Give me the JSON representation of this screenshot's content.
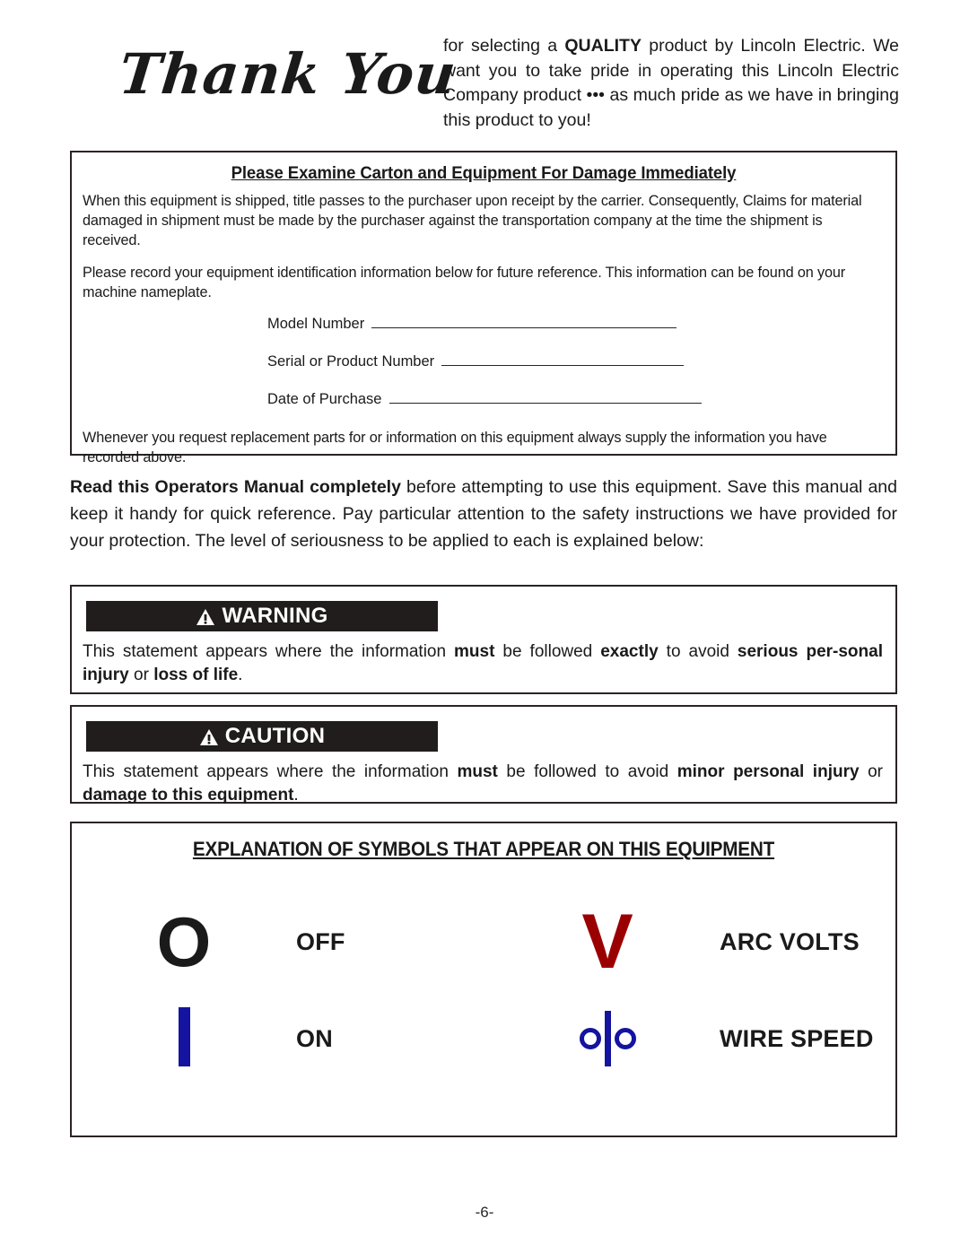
{
  "header": {
    "thank_you": "Thank You",
    "intro_pre": "for selecting a ",
    "intro_bold": "QUALITY",
    "intro_post": " product by Lincoln Electric. We want you to take pride in operating this Lincoln Electric Company product ••• as much pride as we have in bringing this product to you!"
  },
  "examine": {
    "title": "Please Examine Carton and Equipment For Damage Immediately",
    "paragraph1": "When this equipment is shipped, title passes to the purchaser upon receipt by the carrier. Consequently, Claims for material damaged in shipment  must be made by the purchaser against the transportation company at the time the shipment is received.",
    "paragraph2": "Please record your equipment identification information below for future reference. This information can be found on your machine nameplate.",
    "fields": [
      {
        "label": "Model Number",
        "value": ""
      },
      {
        "label": "Serial or Product Number",
        "value": ""
      },
      {
        "label": "Date of Purchase",
        "value": ""
      }
    ],
    "paragraph3": "Whenever you request replacement parts for or information on this equipment always supply the information you have recorded above."
  },
  "read_manual": {
    "bold": "Read this Operators Manual completely",
    "rest": " before attempting to use this equipment. Save this manual and keep it handy for quick reference. Pay particular attention to the safety instructions we have provided for your protection. The level of seriousness to be applied to each is explained below:"
  },
  "warning": {
    "bar_label": "WARNING",
    "icon": "warning-triangle-icon",
    "body_segments": [
      {
        "text": "This statement appears where the information ",
        "bold": false
      },
      {
        "text": "must",
        "bold": true
      },
      {
        "text": " be followed ",
        "bold": false
      },
      {
        "text": "exactly",
        "bold": true
      },
      {
        "text": " to avoid ",
        "bold": false
      },
      {
        "text": "serious per-sonal injury",
        "bold": true
      },
      {
        "text": " or ",
        "bold": false
      },
      {
        "text": "loss of life",
        "bold": true
      },
      {
        "text": ".",
        "bold": false
      }
    ]
  },
  "caution": {
    "bar_label": "CAUTION",
    "icon": "warning-triangle-icon",
    "body_segments": [
      {
        "text": "This statement appears where the information ",
        "bold": false
      },
      {
        "text": "must",
        "bold": true
      },
      {
        "text": " be followed to avoid ",
        "bold": false
      },
      {
        "text": "minor personal injury",
        "bold": true
      },
      {
        "text": " or ",
        "bold": false
      },
      {
        "text": "damage to this equipment",
        "bold": true
      },
      {
        "text": ".",
        "bold": false
      }
    ]
  },
  "symbols": {
    "title": "EXPLANATION OF SYMBOLS THAT APPEAR ON THIS EQUIPMENT",
    "items": [
      {
        "glyph": "O",
        "glyph_name": "power-off-symbol",
        "label": "OFF",
        "color": "#1a1a1a"
      },
      {
        "glyph": "V",
        "glyph_name": "arc-volts-symbol",
        "label": "ARC VOLTS",
        "color": "#9b0000"
      },
      {
        "glyph": "I",
        "glyph_name": "power-on-symbol",
        "label": "ON",
        "color": "#1414a0"
      },
      {
        "glyph": "o|o",
        "glyph_name": "wire-speed-symbol",
        "label": "WIRE SPEED",
        "color": "#1414a0"
      }
    ]
  },
  "footer": {
    "page_number": "-6-"
  },
  "colors": {
    "text": "#1a1a1a",
    "border": "#2b2323",
    "alert_bar": "#211d1d",
    "blue": "#1414a0",
    "red": "#9b0000"
  }
}
